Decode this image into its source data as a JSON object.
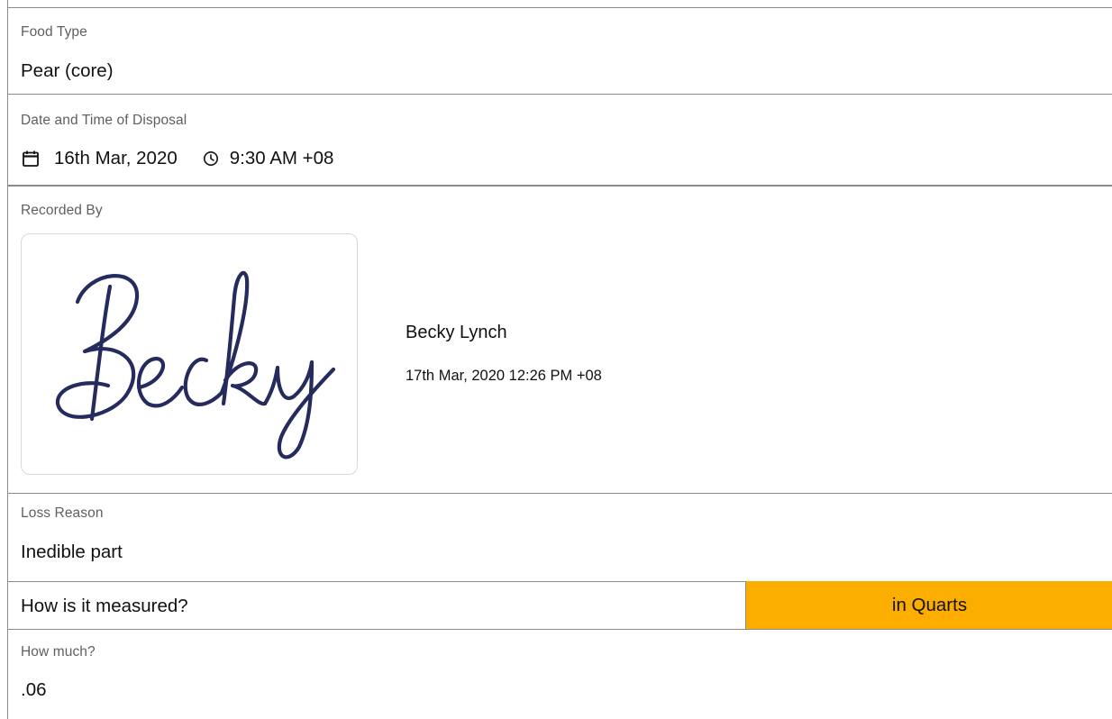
{
  "food_type": {
    "label": "Food Type",
    "value": "Pear (core)"
  },
  "disposal": {
    "label": "Date and Time of Disposal",
    "date": "16th Mar, 2020",
    "time": "9:30 AM +08",
    "date_icon": "calendar-icon",
    "time_icon": "clock-icon"
  },
  "recorded_by": {
    "label": "Recorded By",
    "signature_text": "Becky",
    "name": "Becky Lynch",
    "timestamp": "17th Mar, 2020 12:26 PM +08"
  },
  "loss_reason": {
    "label": "Loss Reason",
    "value": "Inedible part"
  },
  "measurement": {
    "question": "How is it measured?",
    "unit_button": "in Quarts",
    "button_color": "#fcae00"
  },
  "amount": {
    "label": "How much?",
    "value": ".06"
  }
}
